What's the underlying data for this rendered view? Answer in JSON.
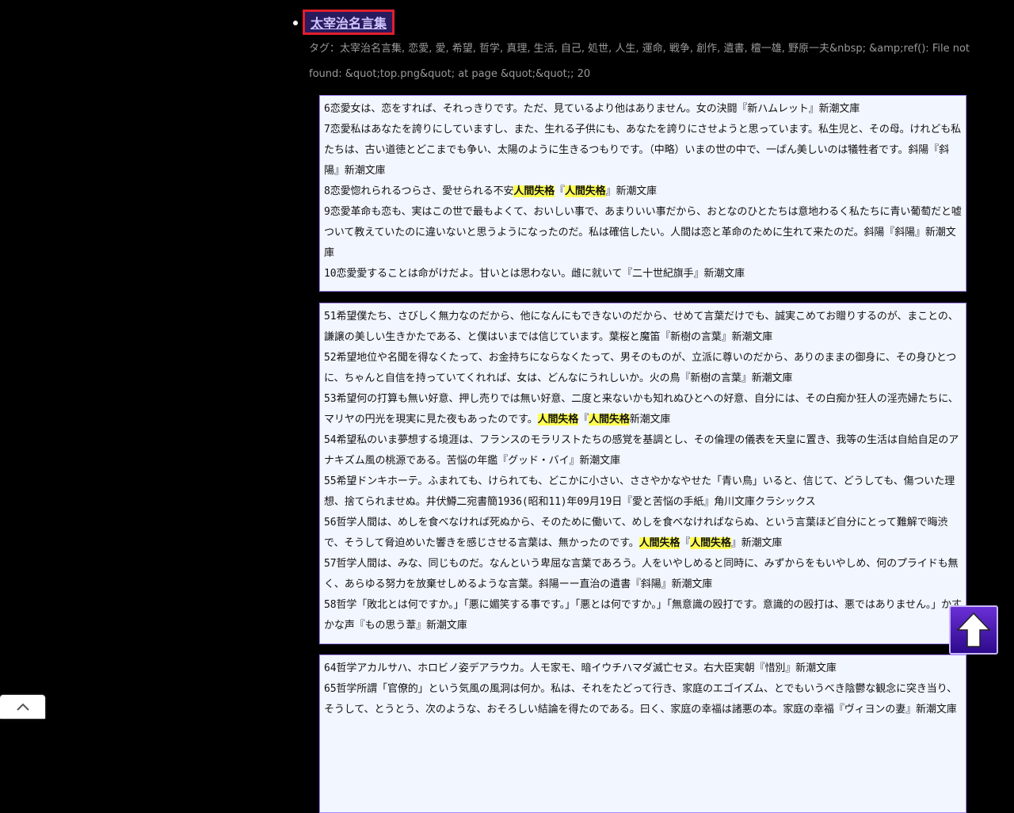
{
  "title": "太宰治名言集",
  "tags_line": "タグ：太宰治名言集, 恋愛, 愛, 希望, 哲学, 真理, 生活, 自己, 処世, 人生, 運命, 戦争, 創作, 遺書, 檀一雄, 野原一夫&nbsp; &amp;ref(): File not found: &quot;top.png&quot; at page &quot;&quot;; 20",
  "boxes": [
    {
      "entries": [
        [
          "6恋愛女は、恋をすれば、それっきりです。ただ、見ているより他はありません。女の決闘『新ハムレット』新潮文庫"
        ],
        [
          "7恋愛私はあなたを誇りにしていますし、また、生れる子供にも、あなたを誇りにさせようと思っています。私生児と、その母。けれども私たちは、古い道徳とどこまでも争い、太陽のように生きるつもりです。（中略）いまの世の中で、一ばん美しいのは犠牲者です。斜陽『斜陽』新潮文庫"
        ],
        [
          "8恋愛惚れられるつらさ、愛せられる不安",
          {
            "hl": "人間失格"
          },
          "『",
          {
            "hl": "人間失格"
          },
          "』新潮文庫"
        ],
        [
          "9恋愛革命も恋も、実はこの世で最もよくて、おいしい事で、あまりいい事だから、おとなのひとたちは意地わるく私たちに青い葡萄だと嘘ついて教えていたのに違いないと思うようになったのだ。私は確信したい。人間は恋と革命のために生れて来たのだ。斜陽『斜陽』新潮文庫"
        ],
        [
          "10恋愛愛することは命がけだよ。甘いとは思わない。雌に就いて『二十世紀旗手』新潮文庫"
        ]
      ]
    },
    {
      "entries": [
        [
          "51希望僕たち、さびしく無力なのだから、他になんにもできないのだから、せめて言葉だけでも、誠実こめてお贈りするのが、まことの、謙譲の美しい生きかたである、と僕はいまでは信じています。葉桜と魔笛『新樹の言葉』新潮文庫"
        ],
        [
          "52希望地位や名聞を得なくたって、お金持ちにならなくたって、男そのものが、立派に尊いのだから、ありのままの御身に、その身ひとつに、ちゃんと自信を持っていてくれれば、女は、どんなにうれしいか。火の鳥『新樹の言葉』新潮文庫"
        ],
        [
          "53希望何の打算も無い好意、押し売りでは無い好意、二度と来ないかも知れぬひとへの好意、自分には、その白痴か狂人の淫売婦たちに、マリヤの円光を現実に見た夜もあったのです。",
          {
            "hl": "人間失格"
          },
          "『",
          {
            "hl": "人間失格"
          },
          "新潮文庫"
        ],
        [
          "54希望私のいま夢想する境涯は、フランスのモラリストたちの感覚を基調とし、その倫理の儀表を天皇に置き、我等の生活は自給自足のアナキズム風の桃源である。苦悩の年鑑『グッド・バイ』新潮文庫"
        ],
        [
          "55希望ドンキホーテ。ふまれても、けられても、どこかに小さい、ささやかなやせた「青い鳥」いると、信じて、どうしても、傷ついた理想、捨てられませぬ。井伏鱒二宛書簡1936(昭和11)年09月19日『愛と苦悩の手紙』角川文庫クラシックス"
        ],
        [
          "56哲学人間は、めしを食べなければ死ぬから、そのために働いて、めしを食べなければならぬ、という言葉ほど自分にとって難解で晦渋で、そうして脅迫めいた響きを感じさせる言葉は、無かったのです。",
          {
            "hl": "人間失格"
          },
          "『",
          {
            "hl": "人間失格"
          },
          "』新潮文庫"
        ],
        [
          "57哲学人間は、みな、同じものだ。なんという卑屈な言葉であろう。人をいやしめると同時に、みずからをもいやしめ、何のプライドも無く、あらゆる努力を放棄せしめるような言葉。斜陽ーー直治の遺書『斜陽』新潮文庫"
        ],
        [
          "58哲学「敗北とは何ですか。」「悪に媚笑する事です。」「悪とは何ですか。」「無意識の殴打です。意識的の殴打は、悪ではありません。」かすかな声『もの思う葦』新潮文庫"
        ]
      ]
    },
    {
      "entries": [
        [
          "64哲学アカルサハ、ホロビノ姿デアラウカ。人モ家モ、暗イウチハマダ滅亡セヌ。右大臣実朝『惜別』新潮文庫"
        ],
        [
          "65哲学所謂「官僚的」という気風の風洞は何か。私は、それをたどって行き、家庭のエゴイズム、とでもいうべき陰鬱な観念に突き当り、そうして、とうとう、次のような、おそろしい結論を得たのである。曰く、家庭の幸福は諸悪の本。家庭の幸福『ヴィヨンの妻』新潮文庫"
        ]
      ]
    }
  ]
}
